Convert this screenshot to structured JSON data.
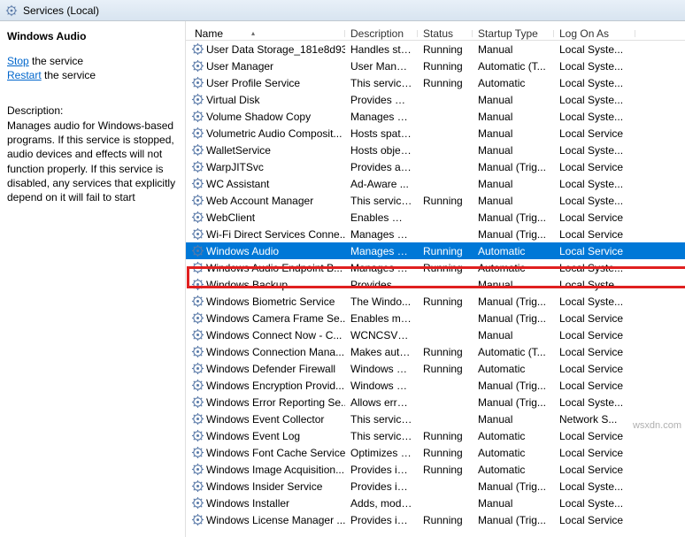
{
  "titlebar": {
    "label": "Services (Local)"
  },
  "details": {
    "name": "Windows Audio",
    "stop_link": "Stop",
    "stop_suffix": " the service",
    "restart_link": "Restart",
    "restart_suffix": " the service",
    "desc_head": "Description:",
    "desc_body": "Manages audio for Windows-based programs.  If this service is stopped, audio devices and effects will not function properly.  If this service is disabled, any services that explicitly depend on it will fail to start"
  },
  "columns": {
    "name": "Name",
    "desc": "Description",
    "status": "Status",
    "startup": "Startup Type",
    "logon": "Log On As"
  },
  "services": [
    {
      "n": "User Data Storage_181e8d93",
      "d": "Handles sto...",
      "s": "Running",
      "t": "Manual",
      "l": "Local Syste..."
    },
    {
      "n": "User Manager",
      "d": "User Manag...",
      "s": "Running",
      "t": "Automatic (T...",
      "l": "Local Syste..."
    },
    {
      "n": "User Profile Service",
      "d": "This service ...",
      "s": "Running",
      "t": "Automatic",
      "l": "Local Syste..."
    },
    {
      "n": "Virtual Disk",
      "d": "Provides m...",
      "s": "",
      "t": "Manual",
      "l": "Local Syste..."
    },
    {
      "n": "Volume Shadow Copy",
      "d": "Manages an...",
      "s": "",
      "t": "Manual",
      "l": "Local Syste..."
    },
    {
      "n": "Volumetric Audio Composit...",
      "d": "Hosts spatia...",
      "s": "",
      "t": "Manual",
      "l": "Local Service"
    },
    {
      "n": "WalletService",
      "d": "Hosts objec...",
      "s": "",
      "t": "Manual",
      "l": "Local Syste..."
    },
    {
      "n": "WarpJITSvc",
      "d": "Provides a JI...",
      "s": "",
      "t": "Manual (Trig...",
      "l": "Local Service"
    },
    {
      "n": "WC Assistant",
      "d": "Ad-Aware ...",
      "s": "",
      "t": "Manual",
      "l": "Local Syste..."
    },
    {
      "n": "Web Account Manager",
      "d": "This service ...",
      "s": "Running",
      "t": "Manual",
      "l": "Local Syste..."
    },
    {
      "n": "WebClient",
      "d": "Enables Win...",
      "s": "",
      "t": "Manual (Trig...",
      "l": "Local Service"
    },
    {
      "n": "Wi-Fi Direct Services Conne...",
      "d": "Manages co...",
      "s": "",
      "t": "Manual (Trig...",
      "l": "Local Service"
    },
    {
      "n": "Windows Audio",
      "d": "Manages au...",
      "s": "Running",
      "t": "Automatic",
      "l": "Local Service",
      "selected": true
    },
    {
      "n": "Windows Audio Endpoint B...",
      "d": "Manages au...",
      "s": "Running",
      "t": "Automatic",
      "l": "Local Syste..."
    },
    {
      "n": "Windows Backup",
      "d": "Provides Wi...",
      "s": "",
      "t": "Manual",
      "l": "Local Syste..."
    },
    {
      "n": "Windows Biometric Service",
      "d": "The Windo...",
      "s": "Running",
      "t": "Manual (Trig...",
      "l": "Local Syste..."
    },
    {
      "n": "Windows Camera Frame Se...",
      "d": "Enables mul...",
      "s": "",
      "t": "Manual (Trig...",
      "l": "Local Service"
    },
    {
      "n": "Windows Connect Now - C...",
      "d": "WCNCSVC ...",
      "s": "",
      "t": "Manual",
      "l": "Local Service"
    },
    {
      "n": "Windows Connection Mana...",
      "d": "Makes auto...",
      "s": "Running",
      "t": "Automatic (T...",
      "l": "Local Service"
    },
    {
      "n": "Windows Defender Firewall",
      "d": "Windows D...",
      "s": "Running",
      "t": "Automatic",
      "l": "Local Service"
    },
    {
      "n": "Windows Encryption Provid...",
      "d": "Windows E...",
      "s": "",
      "t": "Manual (Trig...",
      "l": "Local Service"
    },
    {
      "n": "Windows Error Reporting Se...",
      "d": "Allows error...",
      "s": "",
      "t": "Manual (Trig...",
      "l": "Local Syste..."
    },
    {
      "n": "Windows Event Collector",
      "d": "This service ...",
      "s": "",
      "t": "Manual",
      "l": "Network S..."
    },
    {
      "n": "Windows Event Log",
      "d": "This service ...",
      "s": "Running",
      "t": "Automatic",
      "l": "Local Service"
    },
    {
      "n": "Windows Font Cache Service",
      "d": "Optimizes p...",
      "s": "Running",
      "t": "Automatic",
      "l": "Local Service"
    },
    {
      "n": "Windows Image Acquisition...",
      "d": "Provides im...",
      "s": "Running",
      "t": "Automatic",
      "l": "Local Service"
    },
    {
      "n": "Windows Insider Service",
      "d": "Provides inf...",
      "s": "",
      "t": "Manual (Trig...",
      "l": "Local Syste..."
    },
    {
      "n": "Windows Installer",
      "d": "Adds, modi...",
      "s": "",
      "t": "Manual",
      "l": "Local Syste..."
    },
    {
      "n": "Windows License Manager ...",
      "d": "Provides inf...",
      "s": "Running",
      "t": "Manual (Trig...",
      "l": "Local Service"
    }
  ],
  "watermark": "wsxdn.com"
}
